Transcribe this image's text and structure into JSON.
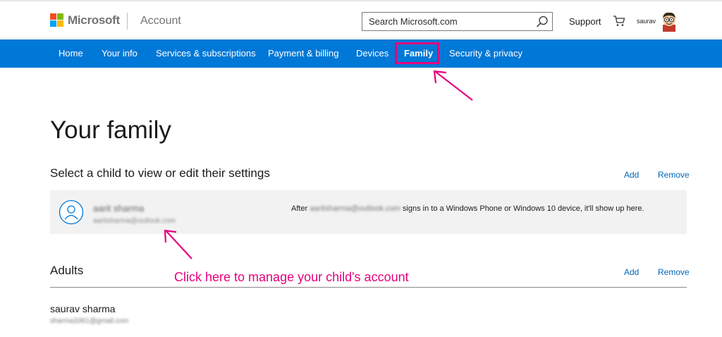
{
  "header": {
    "brand": "Microsoft",
    "section": "Account",
    "search_placeholder": "Search Microsoft.com",
    "support": "Support",
    "username": "saurav"
  },
  "nav": {
    "items": [
      {
        "label": "Home"
      },
      {
        "label": "Your info"
      },
      {
        "label": "Services & subscriptions"
      },
      {
        "label": "Payment & billing"
      },
      {
        "label": "Devices"
      },
      {
        "label": "Family",
        "active": true
      },
      {
        "label": "Security & privacy"
      }
    ]
  },
  "page": {
    "title": "Your family",
    "children_heading": "Select a child to view or edit their settings",
    "add": "Add",
    "remove": "Remove",
    "child": {
      "name": "aarit sharma",
      "email": "aaritsharma@outlook.com",
      "msg_before": "After ",
      "msg_email": "aaritsharma@outlook.com",
      "msg_after": " signs in to a Windows Phone or Windows 10 device, it'll show up here."
    },
    "adults_heading": "Adults",
    "adult": {
      "name": "saurav sharma",
      "email": "sharma3361@gmail.com"
    }
  },
  "annotation": {
    "text": "Click here to manage your child's account",
    "color": "#e6007e"
  },
  "colors": {
    "nav_bg": "#0078d7",
    "link": "#0067b8",
    "highlight": "#e6007e"
  },
  "icons": [
    "microsoft-logo",
    "search-icon",
    "cart-icon",
    "user-avatar",
    "person-icon"
  ]
}
